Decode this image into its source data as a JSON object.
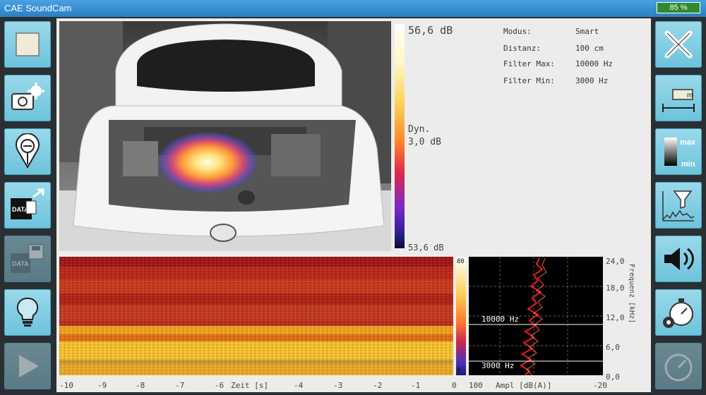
{
  "titlebar": {
    "app_name": "CAE SoundCam",
    "battery": "85 %"
  },
  "left_toolbar": [
    {
      "name": "stop-button",
      "icon": "stop-square-icon"
    },
    {
      "name": "snapshot-settings-button",
      "icon": "camera-gear-icon"
    },
    {
      "name": "location-pin-button",
      "icon": "map-pin-icon"
    },
    {
      "name": "data-export-button",
      "icon": "data-export-icon",
      "label": "DATA"
    },
    {
      "name": "data-save-button",
      "icon": "data-save-icon",
      "label": "DATA",
      "disabled": true
    },
    {
      "name": "light-button",
      "icon": "lightbulb-icon"
    },
    {
      "name": "play-button",
      "icon": "play-icon",
      "disabled": true
    }
  ],
  "right_toolbar": [
    {
      "name": "close-button",
      "icon": "close-icon"
    },
    {
      "name": "distance-button",
      "icon": "ruler-icon",
      "label": "m"
    },
    {
      "name": "min-max-button",
      "icon": "min-max-icon",
      "label_max": "max",
      "label_min": "min"
    },
    {
      "name": "filter-button",
      "icon": "filter-funnel-icon"
    },
    {
      "name": "volume-button",
      "icon": "speaker-icon"
    },
    {
      "name": "timer-settings-button",
      "icon": "stopwatch-gear-icon"
    },
    {
      "name": "compass-button",
      "icon": "compass-icon",
      "disabled": true
    }
  ],
  "scale": {
    "max": "56,6 dB",
    "dyn_label": "Dyn.",
    "dyn_value": "3,0 dB",
    "min": "53,6 dB"
  },
  "info": {
    "mode_label": "Modus:",
    "mode_value": "Smart",
    "distance_label": "Distanz:",
    "distance_value": "100 cm",
    "filter_max_label": "Filter Max:",
    "filter_max_value": "10000 Hz",
    "filter_min_label": "Filter Min:",
    "filter_min_value": "3000 Hz"
  },
  "spectrogram": {
    "x_ticks": [
      "-10",
      "-9",
      "-8",
      "-7",
      "-6",
      "-4",
      "-3",
      "-2",
      "-1",
      "0"
    ],
    "x_label": "Zeit [s]",
    "legend_top": "80",
    "legend_bottom": "0"
  },
  "spectrum": {
    "x_ticks": [
      "100",
      "-20"
    ],
    "x_label": "Ampl [dB(A)]",
    "y_ticks": [
      "24,0",
      "18,0",
      "12,0",
      "6,0",
      "0,0"
    ],
    "y_label": "Frequenz [kHz]",
    "marker_high": "10000 Hz",
    "marker_low": "3000 Hz"
  },
  "colors": {
    "accent": "#6cc3dc",
    "background": "#ecedea",
    "titlebar": "#2b7fc4"
  }
}
